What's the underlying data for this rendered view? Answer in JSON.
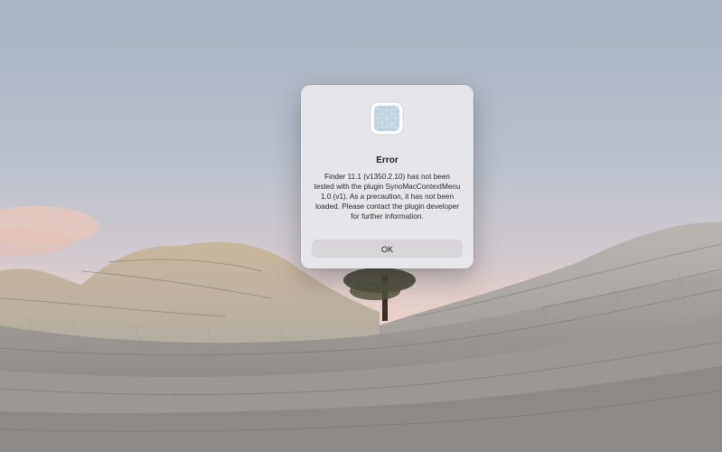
{
  "desktop": {
    "wallpaper": "desert-rock-landscape"
  },
  "alert": {
    "icon": "plugin-placeholder-icon",
    "title": "Error",
    "message": "Finder 11.1 (v1350.2.10) has not been tested with the plugin SynoMacContextMenu 1.0 (v1). As a precaution, it has not been loaded. Please contact the plugin developer for further information.",
    "ok_label": "OK"
  }
}
